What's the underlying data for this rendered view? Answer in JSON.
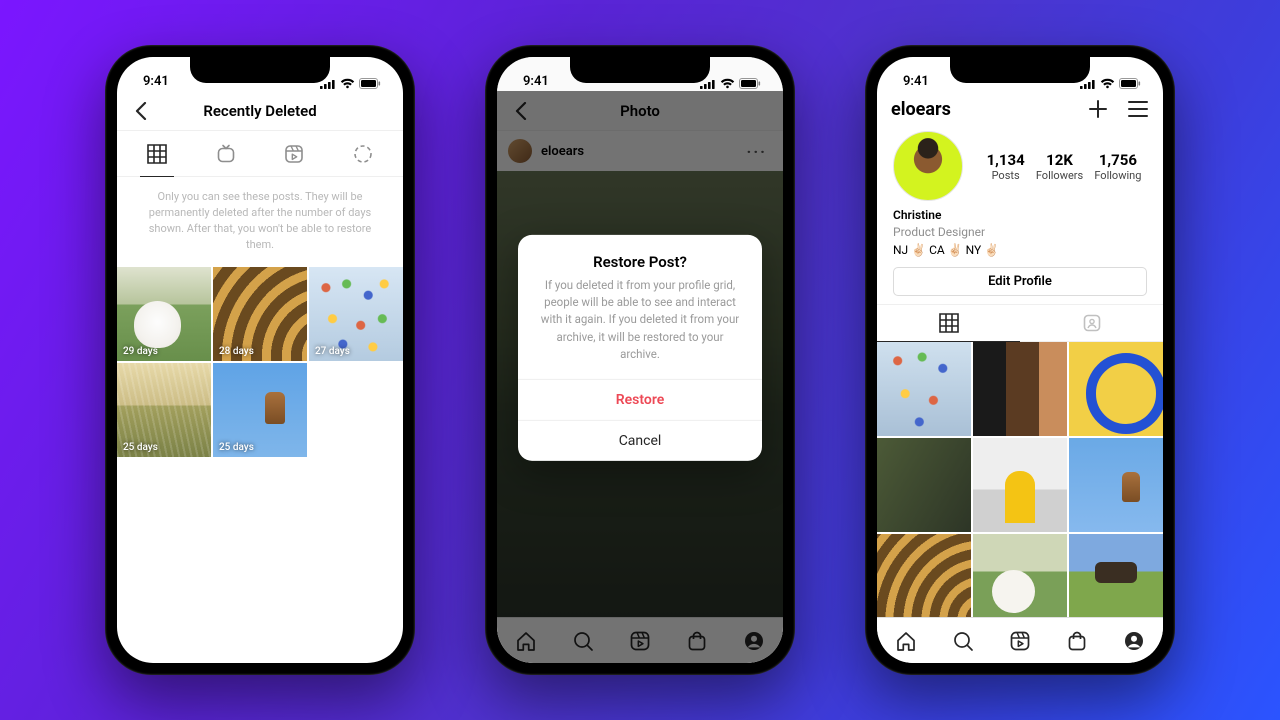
{
  "status": {
    "time": "9:41"
  },
  "phone1": {
    "title": "Recently Deleted",
    "hint": "Only you can see these posts. They will be permanently deleted after the number of days shown. After that, you won't be able to restore them.",
    "tabs": [
      "grid",
      "igtv",
      "reels",
      "story"
    ],
    "items": [
      {
        "days_label": "29 days"
      },
      {
        "days_label": "28 days"
      },
      {
        "days_label": "27 days"
      },
      {
        "days_label": "25 days"
      },
      {
        "days_label": "25 days"
      }
    ]
  },
  "phone2": {
    "title": "Photo",
    "username": "eloears",
    "modal": {
      "title": "Restore Post?",
      "body": "If you deleted it from your profile grid, people will be able to see and interact with it again. If you deleted it from your archive, it will be restored to your archive.",
      "restore": "Restore",
      "cancel": "Cancel"
    }
  },
  "phone3": {
    "username": "eloears",
    "stats": {
      "posts": {
        "num": "1,134",
        "label": "Posts"
      },
      "followers": {
        "num": "12K",
        "label": "Followers"
      },
      "following": {
        "num": "1,756",
        "label": "Following"
      }
    },
    "name": "Christine",
    "role": "Product Designer",
    "location": "NJ ✌🏻 CA ✌🏻 NY ✌🏻",
    "edit": "Edit Profile"
  }
}
